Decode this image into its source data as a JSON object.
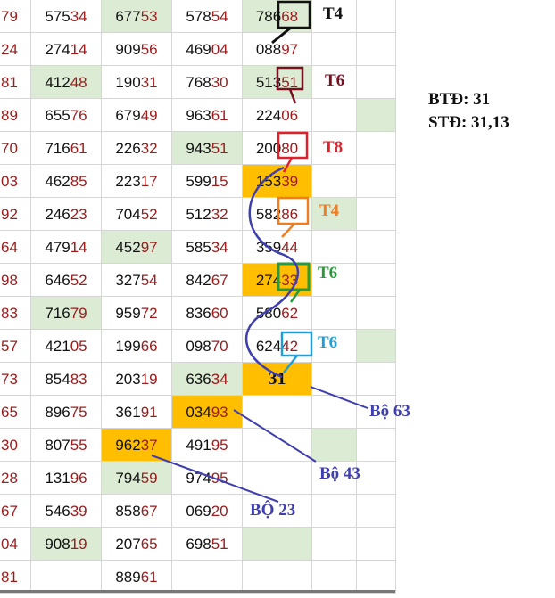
{
  "rows": [
    [
      "79",
      "57534",
      "67753",
      "57854",
      "78668",
      "",
      ""
    ],
    [
      "24",
      "27414",
      "90956",
      "46904",
      "08897",
      "",
      ""
    ],
    [
      "81",
      "41248",
      "19031",
      "76830",
      "51351",
      "",
      ""
    ],
    [
      "89",
      "65576",
      "67949",
      "96361",
      "22406",
      "",
      ""
    ],
    [
      "70",
      "71661",
      "22632",
      "94351",
      "20080",
      "",
      ""
    ],
    [
      "03",
      "46285",
      "22317",
      "59915",
      "15339",
      "",
      ""
    ],
    [
      "92",
      "24623",
      "70452",
      "51232",
      "58286",
      "",
      ""
    ],
    [
      "64",
      "47914",
      "45297",
      "58534",
      "35944",
      "",
      ""
    ],
    [
      "98",
      "64652",
      "32754",
      "84267",
      "27433",
      "",
      ""
    ],
    [
      "83",
      "71679",
      "95972",
      "83660",
      "58062",
      "",
      ""
    ],
    [
      "57",
      "42105",
      "19966",
      "09870",
      "62442",
      "",
      ""
    ],
    [
      "73",
      "85483",
      "20319",
      "63634",
      "31",
      "",
      ""
    ],
    [
      "65",
      "89675",
      "36191",
      "03493",
      "",
      "",
      ""
    ],
    [
      "30",
      "80755",
      "96237",
      "49195",
      "",
      "",
      ""
    ],
    [
      "28",
      "13196",
      "79459",
      "97495",
      "",
      "",
      ""
    ],
    [
      "67",
      "54639",
      "85867",
      "06920",
      "",
      "",
      ""
    ],
    [
      "04",
      "90819",
      "20765",
      "69851",
      "",
      "",
      ""
    ],
    [
      "81",
      "",
      "88961",
      "",
      "",
      "",
      ""
    ]
  ],
  "cell_colors": {
    "green": "#dcebd4",
    "orange": "#ffbf00",
    "digit_highlight": "#9b1c1c"
  },
  "annotations": {
    "btd": "BTĐ: 31",
    "std": "STĐ: 31,13",
    "t4_top": "T4",
    "t6_a": "T6",
    "t8": "T8",
    "t4_mid": "T4",
    "t6_b": "T6",
    "t6_c": "T6",
    "bo63": "Bộ 63",
    "bo43": "Bộ 43",
    "bo23": "BỘ 23"
  },
  "annotation_colors": {
    "black": "#111111",
    "dark_red": "#7a0f1f",
    "red": "#e0202a",
    "orange": "#ef7d22",
    "green": "#2a9a3a",
    "blue": "#1f9fd8",
    "navy": "#3f3fb0"
  }
}
